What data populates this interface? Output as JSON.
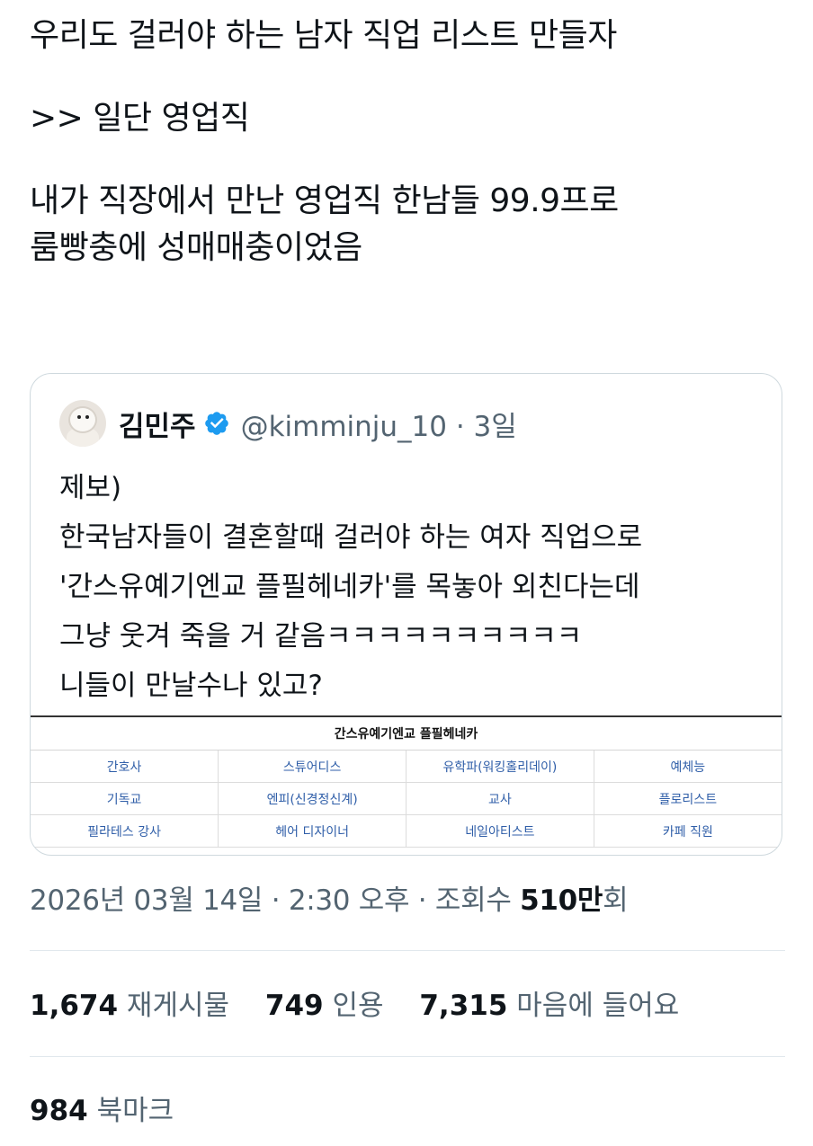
{
  "tweet": {
    "line1": "우리도 걸러야 하는 남자 직업 리스트 만들자",
    "line2": ">> 일단 영업직",
    "line3": "내가 직장에서 만난 영업직 한남들 99.9프로",
    "line4": "룸빵충에 성매매충이었음"
  },
  "quote": {
    "name": "김민주",
    "handle": "@kimminju_10",
    "time": " · 3일",
    "verified_color": "#1d9bf0",
    "lines": [
      "제보)",
      "한국남자들이 결혼할때 걸러야 하는 여자 직업으로",
      "'간스유예기엔교 플필헤네카'를 목놓아 외친다는데",
      "그냥 웃겨 죽을 거 같음ㅋㅋㅋㅋㅋㅋㅋㅋㅋㅋ",
      "니들이 만날수나 있고?"
    ],
    "table": {
      "title": "간스유예기엔교 플필헤네카",
      "rows": [
        [
          "간호사",
          "스튜어디스",
          "유학파(워킹홀리데이)",
          "예체능"
        ],
        [
          "기독교",
          "엔피(신경정신계)",
          "교사",
          "플로리스트"
        ],
        [
          "필라테스 강사",
          "헤어 디자이너",
          "네일아티스트",
          "카페 직원"
        ]
      ],
      "link_color": "#2f5ea8"
    }
  },
  "meta": {
    "datetime": "2026년 03월 14일 · 2:30 오후 · 조회수 ",
    "views_num": "510만",
    "views_unit": "회"
  },
  "stats": {
    "retweets_num": "1,674",
    "retweets_label": "재게시물",
    "quotes_num": "749",
    "quotes_label": "인용",
    "likes_num": "7,315",
    "likes_label": "마음에 들어요",
    "bookmarks_num": "984",
    "bookmarks_label": "북마크"
  }
}
